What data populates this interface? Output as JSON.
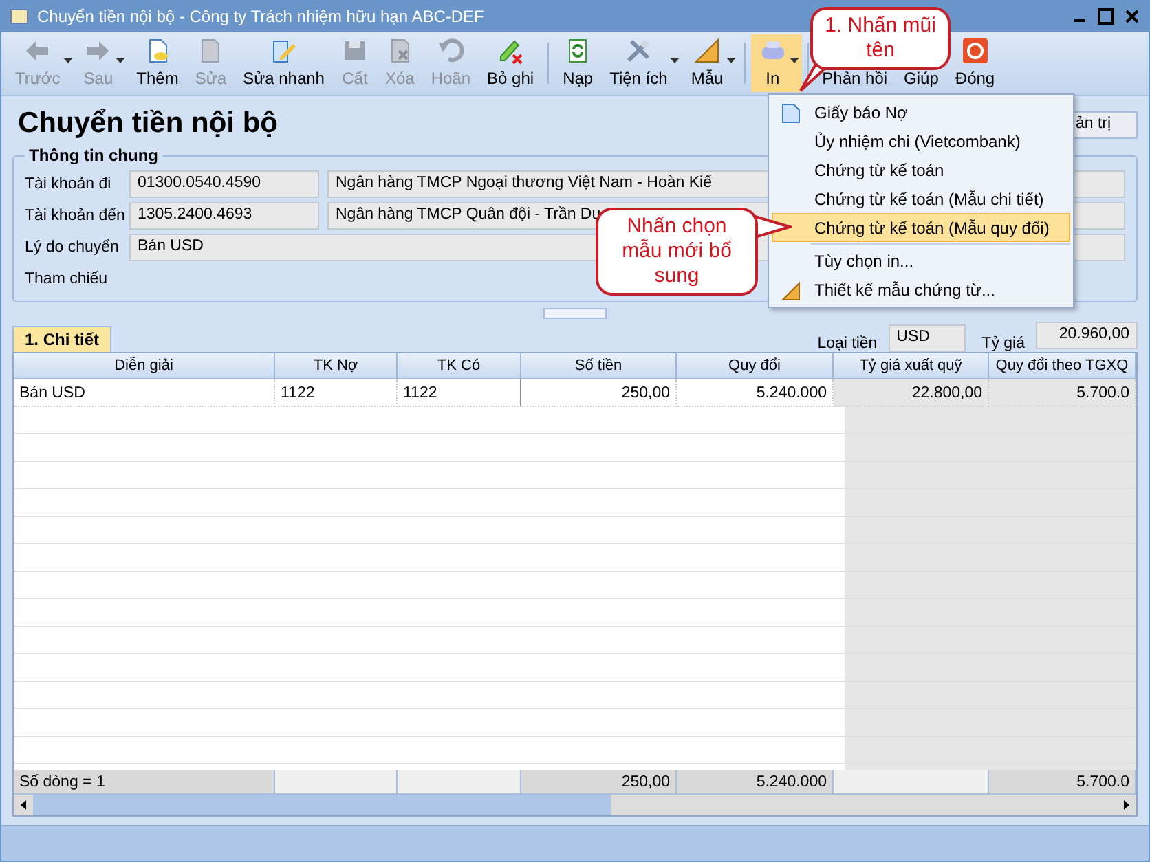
{
  "window": {
    "title": "Chuyển tiền nội bộ - Công ty Trách nhiệm hữu hạn ABC-DEF"
  },
  "toolbar": [
    {
      "kind": "button",
      "label": "Trước",
      "disabled": true,
      "dropdown": true,
      "active": false
    },
    {
      "kind": "button",
      "label": "Sau",
      "disabled": true,
      "dropdown": true,
      "active": false
    },
    {
      "kind": "button",
      "label": "Thêm",
      "disabled": false,
      "dropdown": false,
      "active": false
    },
    {
      "kind": "button",
      "label": "Sửa",
      "disabled": true,
      "dropdown": false,
      "active": false
    },
    {
      "kind": "button",
      "label": "Sửa nhanh",
      "disabled": false,
      "dropdown": false,
      "active": false
    },
    {
      "kind": "button",
      "label": "Cất",
      "disabled": true,
      "dropdown": false,
      "active": false
    },
    {
      "kind": "button",
      "label": "Xóa",
      "disabled": true,
      "dropdown": false,
      "active": false
    },
    {
      "kind": "button",
      "label": "Hoãn",
      "disabled": true,
      "dropdown": false,
      "active": false
    },
    {
      "kind": "button",
      "label": "Bỏ ghi",
      "disabled": false,
      "dropdown": false,
      "active": false
    },
    {
      "kind": "separator"
    },
    {
      "kind": "button",
      "label": "Nạp",
      "disabled": false,
      "dropdown": false,
      "active": false
    },
    {
      "kind": "button",
      "label": "Tiện ích",
      "disabled": false,
      "dropdown": true,
      "active": false
    },
    {
      "kind": "button",
      "label": "Mẫu",
      "disabled": false,
      "dropdown": true,
      "active": false
    },
    {
      "kind": "separator"
    },
    {
      "kind": "button",
      "label": "In",
      "disabled": false,
      "dropdown": true,
      "active": true
    },
    {
      "kind": "separator"
    },
    {
      "kind": "button",
      "label": "Phản hồi",
      "disabled": false,
      "dropdown": false,
      "active": false
    },
    {
      "kind": "button",
      "label": "Giúp",
      "disabled": false,
      "dropdown": false,
      "active": false
    },
    {
      "kind": "button",
      "label": "Đóng",
      "disabled": false,
      "dropdown": false,
      "active": false
    }
  ],
  "heading": "Chuyển tiền nội bộ",
  "admin_button": "ản trị",
  "general_info": {
    "title": "Thông tin chung",
    "fields": [
      {
        "label": "Tài khoản đi",
        "account": "01300.0540.4590",
        "bank": "Ngân hàng TMCP Ngoại thương Việt Nam - Hoàn Kiế"
      },
      {
        "label": "Tài khoản đến",
        "account": "1305.2400.4693",
        "bank": "Ngân hàng TMCP Quân đội  - Trần Du"
      },
      {
        "label": "Lý do chuyển",
        "value": "Bán USD"
      },
      {
        "label": "Tham chiếu"
      }
    ]
  },
  "detail_tab": {
    "label": "1. Chi tiết",
    "selected": true
  },
  "currency": {
    "label": "Loại tiền",
    "value": "USD"
  },
  "rate": {
    "label": "Tỷ giá",
    "value": "20.960,00"
  },
  "table": {
    "columns": [
      "Diễn giải",
      "TK Nợ",
      "TK Có",
      "Số tiền",
      "Quy đổi",
      "Tỷ giá xuất quỹ",
      "Quy đổi theo TGXQ"
    ],
    "rows": [
      [
        "Bán USD",
        "1122",
        "1122",
        "250,00",
        "5.240.000",
        "22.800,00",
        "5.700.0"
      ]
    ],
    "footer": {
      "column_1": "Số dòng = 1",
      "column_4": "250,00",
      "column_5": "5.240.000",
      "column_7": "5.700.0"
    }
  },
  "print_menu": {
    "items": [
      {
        "label": "Giấy báo Nợ",
        "selected": false
      },
      {
        "label": "Ủy nhiệm chi (Vietcombank)",
        "selected": false
      },
      {
        "label": "Chứng từ kế toán",
        "selected": false
      },
      {
        "label": "Chứng từ kế toán (Mẫu chi tiết)",
        "selected": false
      },
      {
        "label": "Chứng từ kế toán (Mẫu quy đổi)",
        "selected": true
      },
      {
        "label": "Tùy chọn in...",
        "selected": false
      },
      {
        "label": "Thiết kế mẫu chứng từ...",
        "selected": false
      }
    ]
  },
  "callouts": [
    "1. Nhấn mũi tên",
    "Nhấn chọn mẫu mới bổ sung"
  ]
}
